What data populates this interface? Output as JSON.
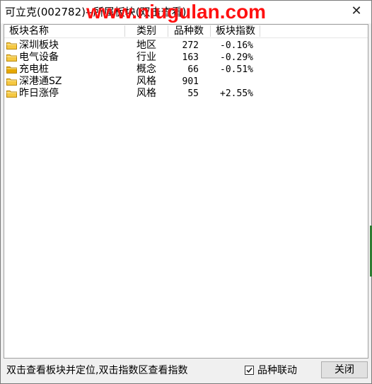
{
  "window": {
    "title": "可立克(002782)--所属板块(双击查看)",
    "watermark": "www.niugulan.com",
    "close_glyph": "✕"
  },
  "list": {
    "columns": [
      "板块名称",
      "类别",
      "品种数",
      "板块指数"
    ],
    "rows": [
      {
        "name": "深圳板块",
        "category": "地区",
        "count": "272",
        "index": "-0.16%",
        "icon": "folder-icon"
      },
      {
        "name": "电气设备",
        "category": "行业",
        "count": "163",
        "index": "-0.29%",
        "icon": "folder-icon"
      },
      {
        "name": "充电桩",
        "category": "概念",
        "count": "66",
        "index": "-0.51%",
        "icon": "folder-icon-highlighted"
      },
      {
        "name": "深港通SZ",
        "category": "风格",
        "count": "901",
        "index": "",
        "icon": "folder-icon"
      },
      {
        "name": "昨日涨停",
        "category": "风格",
        "count": "55",
        "index": "+2.55%",
        "icon": "folder-icon"
      }
    ]
  },
  "footer": {
    "hint": "双击查看板块并定位,双击指数区查看指数",
    "checkbox_label": "品种联动",
    "checkbox_checked": true,
    "close_button": "关闭"
  },
  "colors": {
    "watermark": "#ff1010",
    "folder": "#f5c842",
    "folder_highlight": "#e6a800",
    "edge_accent": "#2e7d32"
  }
}
